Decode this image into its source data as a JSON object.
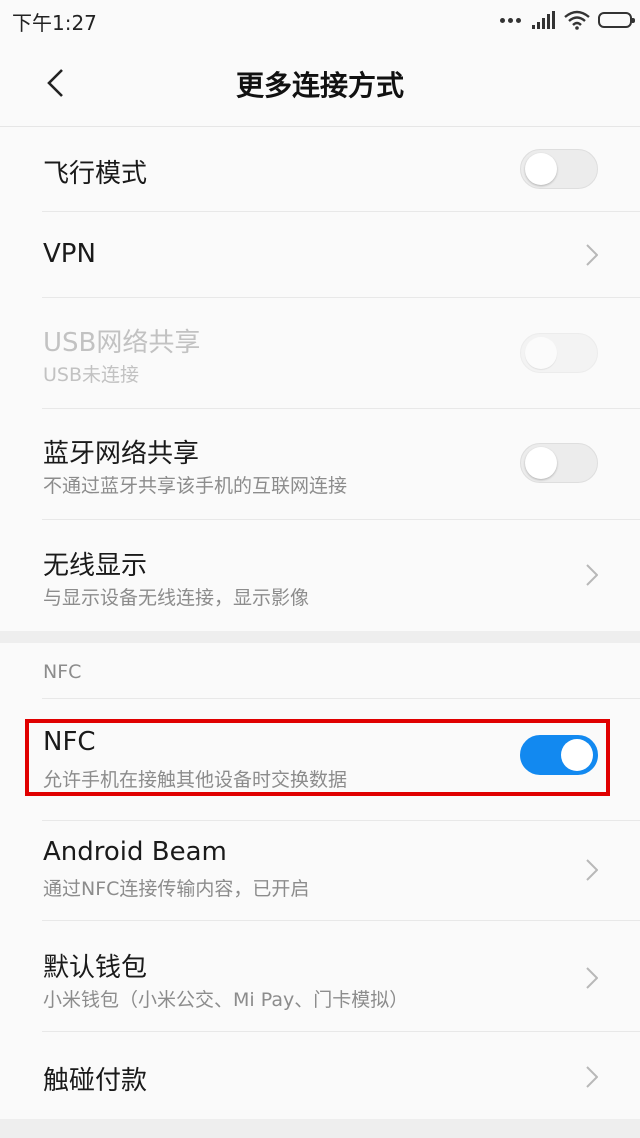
{
  "status_bar": {
    "time": "下午1:27"
  },
  "header": {
    "title": "更多连接方式"
  },
  "items": [
    {
      "title": "飞行模式",
      "subtitle": "",
      "control": "toggle",
      "state": "off"
    },
    {
      "title": "VPN",
      "subtitle": "",
      "control": "chevron"
    },
    {
      "title": "USB网络共享",
      "subtitle": "USB未连接",
      "control": "toggle",
      "state": "disabled"
    },
    {
      "title": "蓝牙网络共享",
      "subtitle": "不通过蓝牙共享该手机的互联网连接",
      "control": "toggle",
      "state": "off"
    },
    {
      "title": "无线显示",
      "subtitle": "与显示设备无线连接，显示影像",
      "control": "chevron"
    }
  ],
  "nfc_section": {
    "label": "NFC",
    "items": [
      {
        "title": "NFC",
        "subtitle": "允许手机在接触其他设备时交换数据",
        "control": "toggle",
        "state": "on"
      },
      {
        "title": "Android Beam",
        "subtitle": "通过NFC连接传输内容，已开启",
        "control": "chevron"
      },
      {
        "title": "默认钱包",
        "subtitle": "小米钱包（小米公交、Mi Pay、门卡模拟）",
        "control": "chevron"
      },
      {
        "title": "触碰付款",
        "subtitle": "",
        "control": "chevron"
      }
    ]
  },
  "colors": {
    "accent": "#1289f0",
    "highlight_border": "#e00000",
    "background": "#fafafa",
    "section_gap": "#eeeeee"
  },
  "icons": [
    "back-arrow-icon",
    "chevron-right-icon",
    "signal-icon",
    "wifi-icon",
    "battery-icon"
  ]
}
